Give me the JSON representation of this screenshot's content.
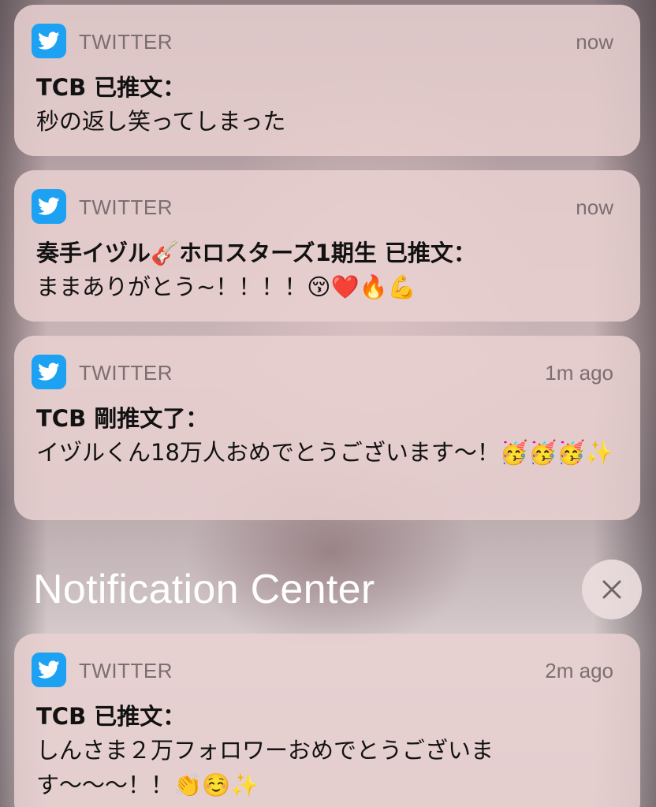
{
  "notifications": [
    {
      "app": "TWITTER",
      "time": "now",
      "title": "TCB 已推文：",
      "message": "秒の返し笑ってしまった"
    },
    {
      "app": "TWITTER",
      "time": "now",
      "title": "奏手イヅル🎸ホロスターズ1期生 已推文：",
      "message": "ままありがとう~！！！！😚❤️🔥💪"
    },
    {
      "app": "TWITTER",
      "time": "1m ago",
      "title": "TCB 剛推文了：",
      "message": "イヅルくん18万人おめでとうございます〜！🥳🥳🥳✨"
    },
    {
      "app": "TWITTER",
      "time": "2m ago",
      "title": "TCB 已推文：",
      "message": "しんさま２万フォロワーおめでとうございます〜〜〜！！👏☺️✨"
    }
  ],
  "notification_center": {
    "title": "Notification Center",
    "clear_icon": "close-icon"
  },
  "colors": {
    "twitter_blue": "#1da1f2",
    "card_background": "#e9d0d1",
    "header_text": "#ffffff"
  }
}
